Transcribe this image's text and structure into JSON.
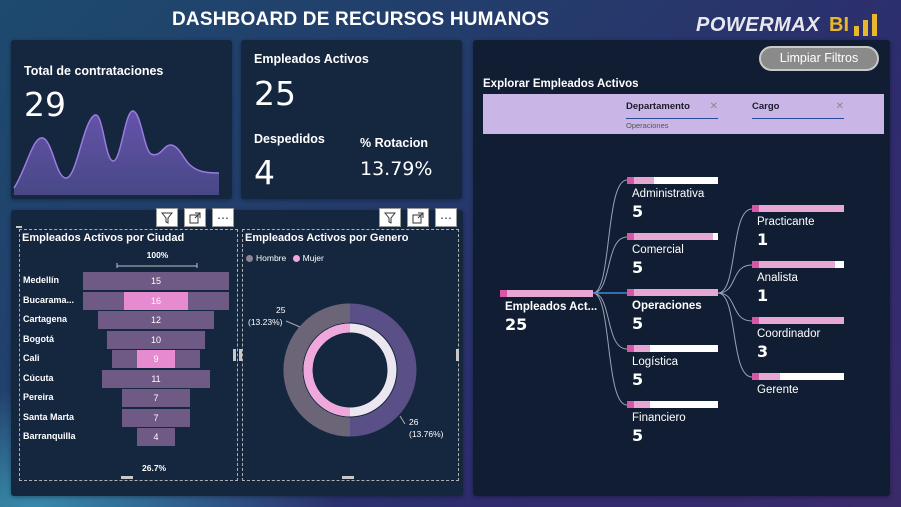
{
  "header": {
    "title": "DASHBOARD DE RECURSOS HUMANOS",
    "brand": "POWERMAX",
    "brand_suffix": "BI"
  },
  "kpis": {
    "contrataciones_label": "Total de contrataciones",
    "contrataciones_value": "29",
    "activos_label": "Empleados Activos",
    "activos_value": "25",
    "despedidos_label": "Despedidos",
    "despedidos_value": "4",
    "rotacion_label": "% Rotacion",
    "rotacion_value": "13.79%"
  },
  "funnel": {
    "title": "Empleados Activos por Ciudad",
    "top_pct": "100%",
    "bottom_pct": "26.7%",
    "max": 15,
    "highlight_color": "#e78bd0",
    "rows": [
      {
        "city": "Medellín",
        "value": 15,
        "highlight": false
      },
      {
        "city": "Bucarama...",
        "value": 16,
        "highlight": true
      },
      {
        "city": "Cartagena",
        "value": 12,
        "highlight": false
      },
      {
        "city": "Bogotá",
        "value": 10,
        "highlight": false
      },
      {
        "city": "Cali",
        "value": 9,
        "highlight": true
      },
      {
        "city": "Cúcuta",
        "value": 11,
        "highlight": false
      },
      {
        "city": "Pereira",
        "value": 7,
        "highlight": false
      },
      {
        "city": "Santa Marta",
        "value": 7,
        "highlight": false
      },
      {
        "city": "Barranquilla",
        "value": 4,
        "highlight": false
      }
    ]
  },
  "donut": {
    "title": "Empleados Activos por Genero",
    "legend": [
      {
        "label": "Hombre",
        "color": "#8a8590"
      },
      {
        "label": "Mujer",
        "color": "#f0a8dc"
      }
    ],
    "label_left_value": "25",
    "label_left_pct": "(13.23%)",
    "label_right_value": "26",
    "label_right_pct": "(13.76%)"
  },
  "tree": {
    "clear_button": "Limpiar Filtros",
    "title": "Explorar Empleados Activos",
    "slicers": [
      {
        "label": "Departamento",
        "value": "Operaciones"
      },
      {
        "label": "Cargo",
        "value": ""
      }
    ],
    "root": {
      "label": "Empleados Act...",
      "value": "25"
    },
    "departments": [
      {
        "label": "Administrativa",
        "value": "5",
        "fill": 0.3
      },
      {
        "label": "Comercial",
        "value": "5",
        "fill": 0.95
      },
      {
        "label": "Operaciones",
        "value": "5",
        "fill": 1.0
      },
      {
        "label": "Logística",
        "value": "5",
        "fill": 0.25
      },
      {
        "label": "Financiero",
        "value": "5",
        "fill": 0.25
      }
    ],
    "roles": [
      {
        "label": "Practicante",
        "value": "1",
        "fill": 1.0
      },
      {
        "label": "Analista",
        "value": "1",
        "fill": 0.9
      },
      {
        "label": "Coordinador",
        "value": "3",
        "fill": 1.0
      },
      {
        "label": "Gerente",
        "value": "",
        "fill": 0.3
      }
    ]
  }
}
